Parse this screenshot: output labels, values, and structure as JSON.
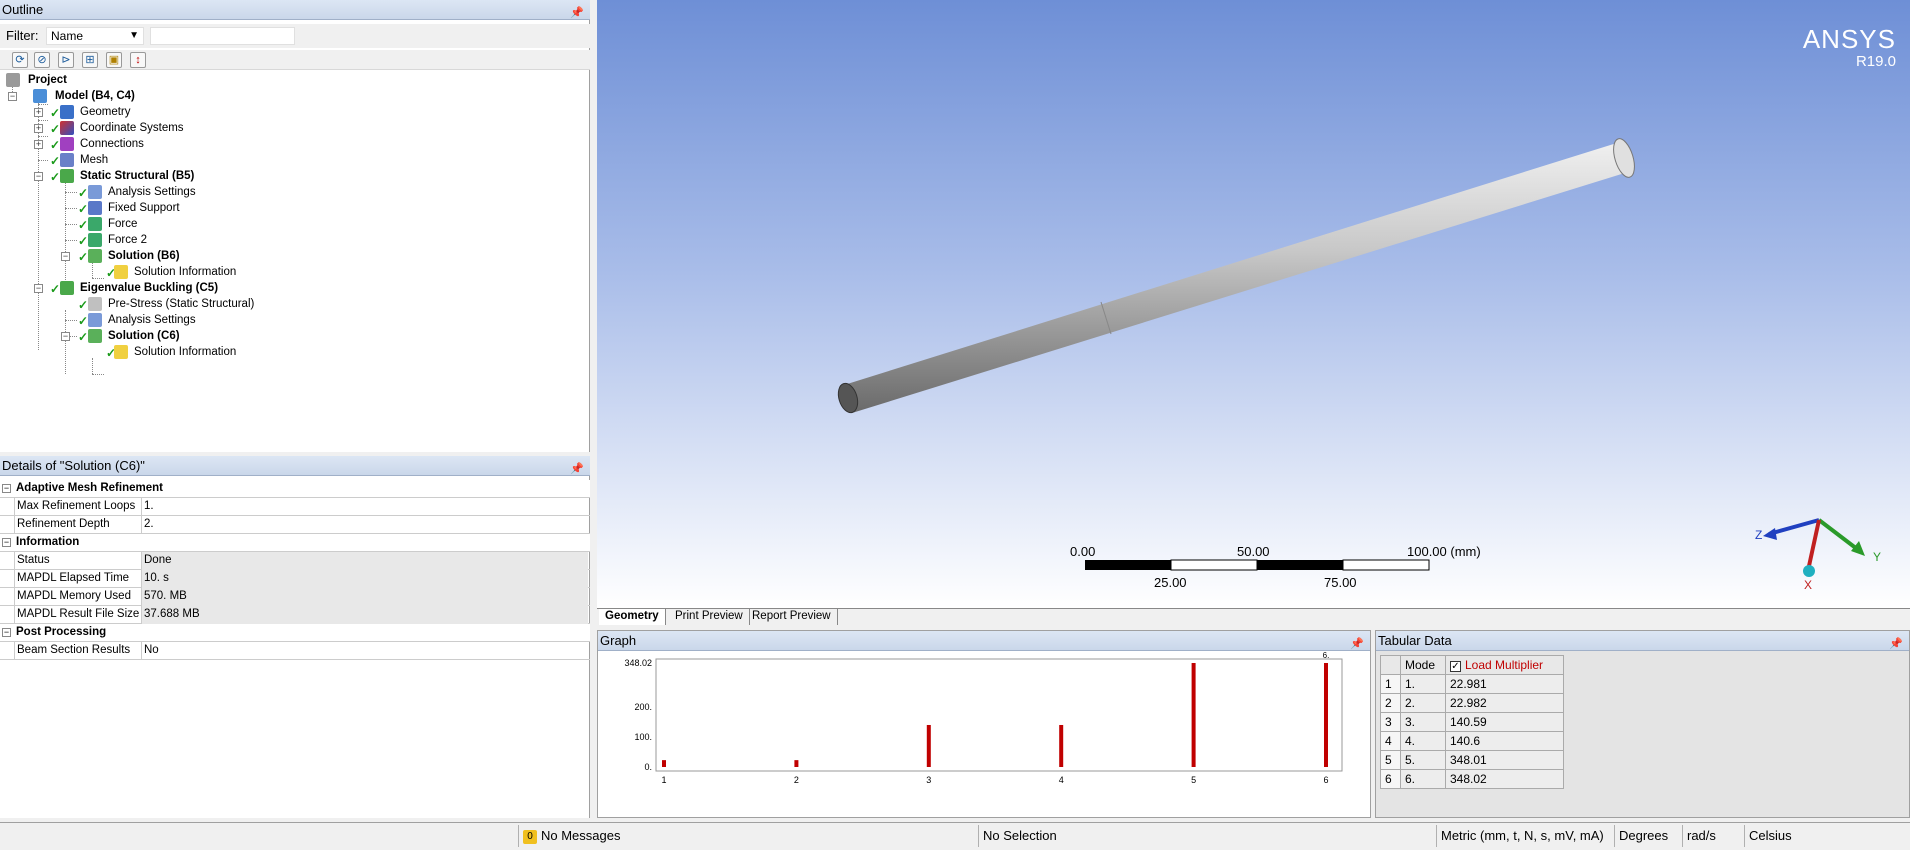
{
  "outline": {
    "title": "Outline",
    "filter_label": "Filter:",
    "filter_value": "Name",
    "tree": {
      "project": "Project",
      "model": "Model (B4, C4)",
      "geometry": "Geometry",
      "coordinate_systems": "Coordinate Systems",
      "connections": "Connections",
      "mesh": "Mesh",
      "static_structural": "Static Structural (B5)",
      "analysis_settings_1": "Analysis Settings",
      "fixed_support": "Fixed Support",
      "force": "Force",
      "force2": "Force 2",
      "solution_b6": "Solution (B6)",
      "solution_info_1": "Solution Information",
      "eigenvalue_buckling": "Eigenvalue Buckling (C5)",
      "pre_stress": "Pre-Stress (Static Structural)",
      "analysis_settings_2": "Analysis Settings",
      "solution_c6": "Solution (C6)",
      "solution_info_2": "Solution Information"
    }
  },
  "details": {
    "title": "Details of \"Solution (C6)\"",
    "groups": {
      "adaptive": "Adaptive Mesh Refinement",
      "information": "Information",
      "post": "Post Processing"
    },
    "rows": {
      "max_refinement_loops": {
        "key": "Max Refinement Loops",
        "value": "1."
      },
      "refinement_depth": {
        "key": "Refinement Depth",
        "value": "2."
      },
      "status": {
        "key": "Status",
        "value": "Done"
      },
      "elapsed": {
        "key": "MAPDL Elapsed Time",
        "value": "10. s"
      },
      "memory": {
        "key": "MAPDL Memory Used",
        "value": "570. MB"
      },
      "result_size": {
        "key": "MAPDL Result File Size",
        "value": "37.688 MB"
      },
      "beam_results": {
        "key": "Beam Section Results",
        "value": "No"
      }
    }
  },
  "viewport": {
    "brand": "ANSYS",
    "version": "R19.0",
    "scale_top": [
      "0.00",
      "50.00",
      "100.00 (mm)"
    ],
    "scale_bottom": [
      "25.00",
      "75.00"
    ],
    "axes": {
      "x": "X",
      "y": "Y",
      "z": "Z"
    }
  },
  "tabs": [
    "Geometry",
    "Print Preview",
    "Report Preview"
  ],
  "graph": {
    "title": "Graph",
    "y_ticks": [
      "348.02",
      "200.",
      "100.",
      "0."
    ],
    "peak_label": "6."
  },
  "chart_data": {
    "type": "bar",
    "categories": [
      "1",
      "2",
      "3",
      "4",
      "5",
      "6"
    ],
    "values": [
      22.981,
      22.982,
      140.59,
      140.6,
      348.01,
      348.02
    ],
    "ylim": [
      0,
      348.02
    ],
    "grid": false,
    "color": "#c00000"
  },
  "tabular": {
    "title": "Tabular Data",
    "columns": [
      "Mode",
      "Load Multiplier"
    ],
    "rows": [
      {
        "n": "1",
        "mode": "1.",
        "value": "22.981"
      },
      {
        "n": "2",
        "mode": "2.",
        "value": "22.982"
      },
      {
        "n": "3",
        "mode": "3.",
        "value": "140.59"
      },
      {
        "n": "4",
        "mode": "4.",
        "value": "140.6"
      },
      {
        "n": "5",
        "mode": "5.",
        "value": "348.01"
      },
      {
        "n": "6",
        "mode": "6.",
        "value": "348.02"
      }
    ]
  },
  "status": {
    "messages_count": "0",
    "messages": "No Messages",
    "selection": "No Selection",
    "units": "Metric (mm, t, N, s, mV, mA)",
    "angle": "Degrees",
    "rate": "rad/s",
    "temperature": "Celsius"
  },
  "colors": {
    "accent_red": "#c00000",
    "header_blue": "#dce6f4"
  }
}
